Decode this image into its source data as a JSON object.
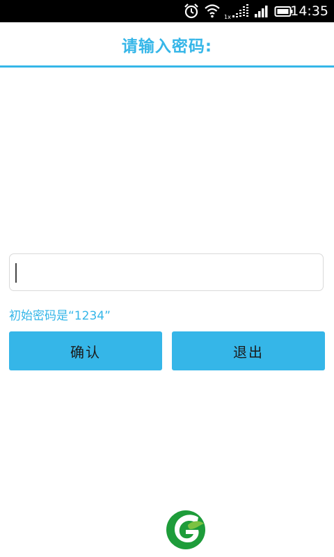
{
  "status_bar": {
    "time": "14:35",
    "icons": [
      "alarm-icon",
      "wifi-icon",
      "signal-1x-icon",
      "signal-icon",
      "battery-icon"
    ]
  },
  "header": {
    "title": "请输入密码:"
  },
  "form": {
    "password_value": "",
    "hint": "初始密码是“1234”"
  },
  "buttons": {
    "confirm_label": "确认",
    "exit_label": "退出"
  },
  "colors": {
    "accent": "#35b6e8",
    "logo_green": "#1e9c3a"
  }
}
